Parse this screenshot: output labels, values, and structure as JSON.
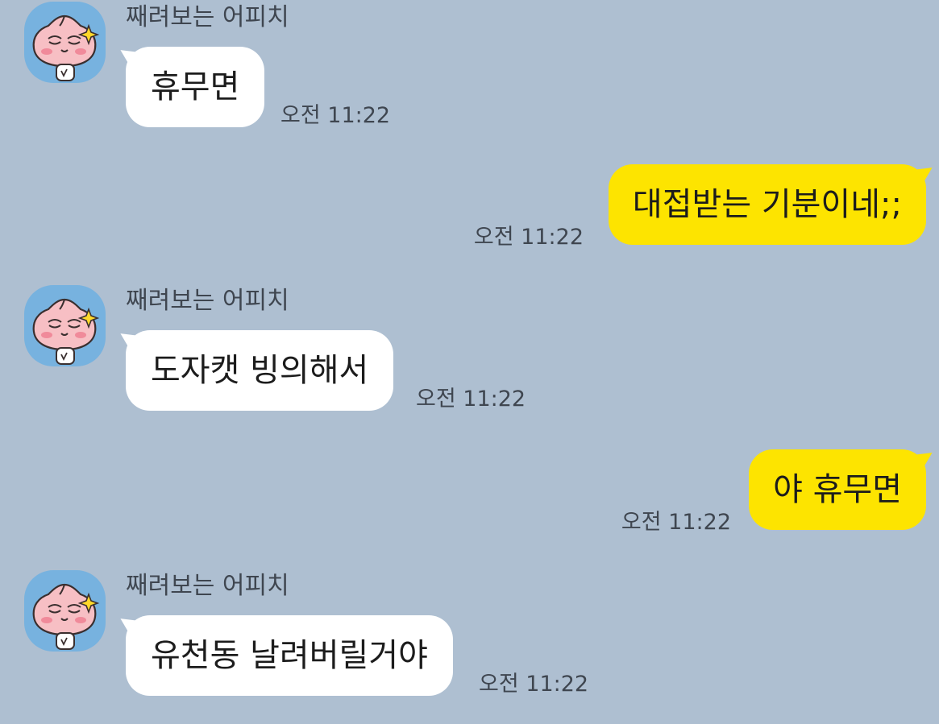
{
  "friend": {
    "name": "째려보는 어피치",
    "avatar_icon": "apeach-glare-avatar-icon",
    "avatar_bg": "#77b2df"
  },
  "colors": {
    "background": "#aebfd1",
    "incoming_bubble": "#ffffff",
    "outgoing_bubble": "#fde400",
    "meta_text": "#3f4650"
  },
  "messages": [
    {
      "direction": "incoming",
      "sender": "째려보는 어피치",
      "text": "휴무면",
      "time": "오전 11:22"
    },
    {
      "direction": "outgoing",
      "text": "대접받는 기분이네;;",
      "time": "오전 11:22"
    },
    {
      "direction": "incoming",
      "sender": "째려보는 어피치",
      "text": "도자캣 빙의해서",
      "time": "오전 11:22"
    },
    {
      "direction": "outgoing",
      "text": "야 휴무면",
      "time": "오전 11:22"
    },
    {
      "direction": "incoming",
      "sender": "째려보는 어피치",
      "text": "유천동 날려버릴거야",
      "time": "오전 11:22"
    }
  ]
}
